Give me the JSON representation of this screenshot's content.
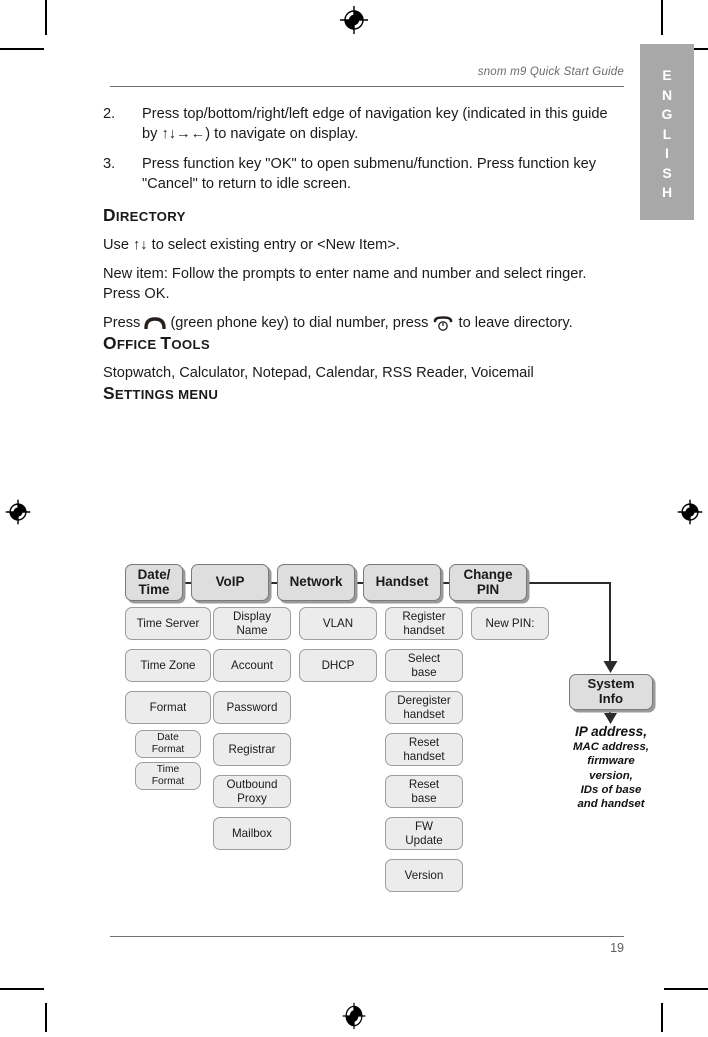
{
  "header": {
    "title": "snom m9 Quick Start Guide"
  },
  "footer": {
    "page_number": "19"
  },
  "language_tab": {
    "label": "ENGLISH",
    "letters": [
      "E",
      "N",
      "G",
      "L",
      "I",
      "S",
      "H"
    ],
    "background_color": "#a8a8a8",
    "text_color": "#ffffff"
  },
  "steps": [
    {
      "number": "2.",
      "text": "Press top/bottom/right/left edge of navigation key (indicated in this guide by ↑↓→←) to navigate on display."
    },
    {
      "number": "3.",
      "text": "Press function key \"OK\" to open submenu/function. Press function key \"Cancel\" to return to idle screen."
    }
  ],
  "sections": {
    "directory": {
      "heading_cap": "D",
      "heading_rest": "IRECTORY",
      "p1": "Use ↑↓ to select existing entry or <New Item>.",
      "p2": "New item:  Follow the prompts to enter name and number and select ringer.  Press OK.",
      "p3_before": "Press",
      "p3_middle": "(green phone key) to dial number, press",
      "p3_after": "to leave directory."
    },
    "office_tools": {
      "heading_cap1": "O",
      "heading_rest1": "FFICE",
      "heading_cap2": "T",
      "heading_rest2": "OOLS",
      "body": "Stopwatch, Calculator, Notepad, Calendar, RSS Reader, Voicemail"
    },
    "settings_menu": {
      "heading_cap": "S",
      "heading_rest": "ETTINGS MENU"
    }
  },
  "diagram": {
    "columns": [
      {
        "head": "Date/\nTime",
        "items": [
          "Time Server",
          "Time Zone",
          "Format"
        ],
        "nested": [
          "Date\nFormat",
          "Time\nFormat"
        ]
      },
      {
        "head": "VoIP",
        "items": [
          "Display\nName",
          "Account",
          "Password",
          "Registrar",
          "Outbound\nProxy",
          "Mailbox"
        ],
        "nested": []
      },
      {
        "head": "Network",
        "items": [
          "VLAN",
          "DHCP"
        ],
        "nested": []
      },
      {
        "head": "Handset",
        "items": [
          "Register\nhandset",
          "Select\nbase",
          "Deregister\nhandset",
          "Reset\nhandset",
          "Reset\nbase",
          "FW\nUpdate",
          "Version"
        ],
        "nested": []
      },
      {
        "head": "Change\nPIN",
        "items": [
          "New PIN:"
        ],
        "nested": []
      }
    ],
    "system_info": {
      "box_label": "System\nInfo",
      "detail_line1": "IP address,",
      "detail_rest": "MAC address,\nfirmware\nversion,\nIDs of base\nand handset"
    },
    "colors": {
      "head_fill": "#dedede",
      "sub_fill": "#ececec",
      "border": "#8e8e8e",
      "shadow": "#9a9a9a"
    }
  }
}
